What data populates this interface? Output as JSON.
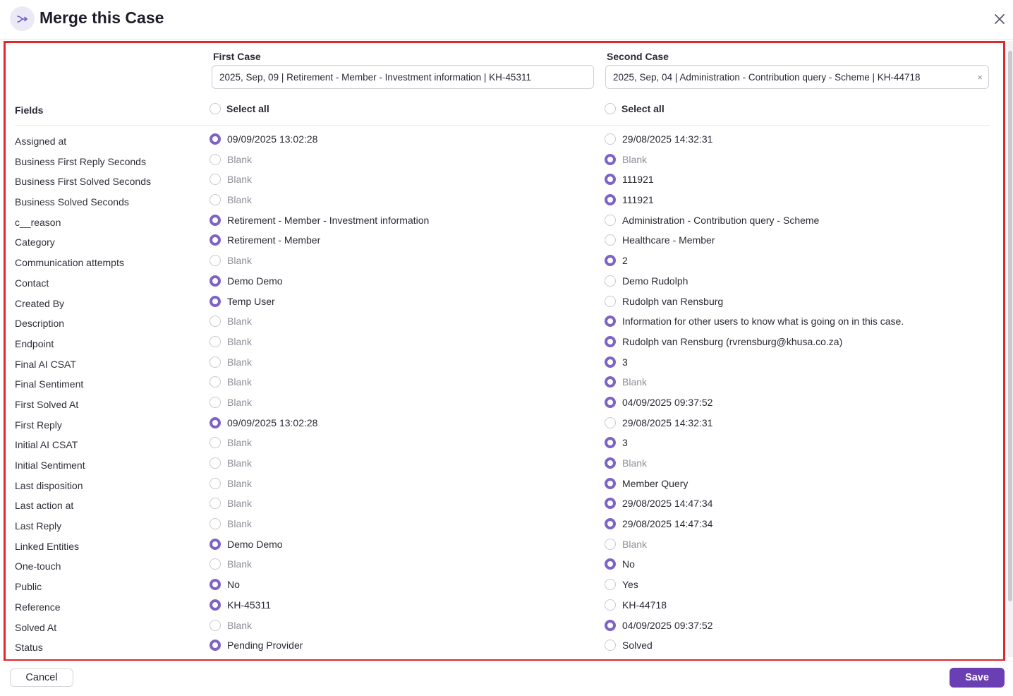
{
  "dialog": {
    "title": "Merge this Case",
    "icon": "merge-icon",
    "close_icon": "close-icon"
  },
  "columns": {
    "fields_label": "Fields",
    "first": {
      "heading": "First Case",
      "selected": "2025, Sep, 09 | Retirement - Member - Investment information | KH-45311",
      "select_all": "Select all"
    },
    "second": {
      "heading": "Second Case",
      "selected": "2025, Sep, 04 | Administration - Contribution query - Scheme | KH-44718",
      "select_all": "Select all",
      "clear": "×"
    }
  },
  "rows": [
    {
      "label": "Assigned at",
      "first": "09/09/2025 13:02:28",
      "second": "29/08/2025 14:32:31",
      "selected": "first"
    },
    {
      "label": "Business First Reply Seconds",
      "first": "Blank",
      "second": "Blank",
      "selected": "second"
    },
    {
      "label": "Business First Solved Seconds",
      "first": "Blank",
      "second": "111921",
      "selected": "second"
    },
    {
      "label": "Business Solved Seconds",
      "first": "Blank",
      "second": "111921",
      "selected": "second"
    },
    {
      "label": "c__reason",
      "first": "Retirement - Member - Investment information",
      "second": "Administration - Contribution query - Scheme",
      "selected": "first"
    },
    {
      "label": "Category",
      "first": "Retirement - Member",
      "second": "Healthcare - Member",
      "selected": "first"
    },
    {
      "label": "Communication attempts",
      "first": "Blank",
      "second": "2",
      "selected": "second"
    },
    {
      "label": "Contact",
      "first": "Demo Demo",
      "second": "Demo Rudolph",
      "selected": "first"
    },
    {
      "label": "Created By",
      "first": "Temp User",
      "second": "Rudolph van Rensburg",
      "selected": "first"
    },
    {
      "label": "Description",
      "first": "Blank",
      "second": "Information for other users to know what is going on in this case.",
      "selected": "second"
    },
    {
      "label": "Endpoint",
      "first": "Blank",
      "second": "Rudolph van Rensburg (rvrensburg@khusa.co.za)",
      "selected": "second"
    },
    {
      "label": "Final AI CSAT",
      "first": "Blank",
      "second": "3",
      "selected": "second"
    },
    {
      "label": "Final Sentiment",
      "first": "Blank",
      "second": "Blank",
      "selected": "second"
    },
    {
      "label": "First Solved At",
      "first": "Blank",
      "second": "04/09/2025 09:37:52",
      "selected": "second"
    },
    {
      "label": "First Reply",
      "first": "09/09/2025 13:02:28",
      "second": "29/08/2025 14:32:31",
      "selected": "first"
    },
    {
      "label": "Initial AI CSAT",
      "first": "Blank",
      "second": "3",
      "selected": "second"
    },
    {
      "label": "Initial Sentiment",
      "first": "Blank",
      "second": "Blank",
      "selected": "second"
    },
    {
      "label": "Last disposition",
      "first": "Blank",
      "second": "Member Query",
      "selected": "second"
    },
    {
      "label": "Last action at",
      "first": "Blank",
      "second": "29/08/2025 14:47:34",
      "selected": "second"
    },
    {
      "label": "Last Reply",
      "first": "Blank",
      "second": "29/08/2025 14:47:34",
      "selected": "second"
    },
    {
      "label": "Linked Entities",
      "first": "Demo Demo",
      "second": "Blank",
      "selected": "first"
    },
    {
      "label": "One-touch",
      "first": "Blank",
      "second": "No",
      "selected": "second"
    },
    {
      "label": "Public",
      "first": "No",
      "second": "Yes",
      "selected": "first"
    },
    {
      "label": "Reference",
      "first": "KH-45311",
      "second": "KH-44718",
      "selected": "first"
    },
    {
      "label": "Solved At",
      "first": "Blank",
      "second": "04/09/2025 09:37:52",
      "selected": "second"
    },
    {
      "label": "Status",
      "first": "Pending Provider",
      "second": "Solved",
      "selected": "first"
    }
  ],
  "footer": {
    "cancel": "Cancel",
    "save": "Save"
  },
  "colors": {
    "accent": "#7e63c6",
    "save_button": "#6a3fb3",
    "highlight_border": "#e0272b"
  }
}
